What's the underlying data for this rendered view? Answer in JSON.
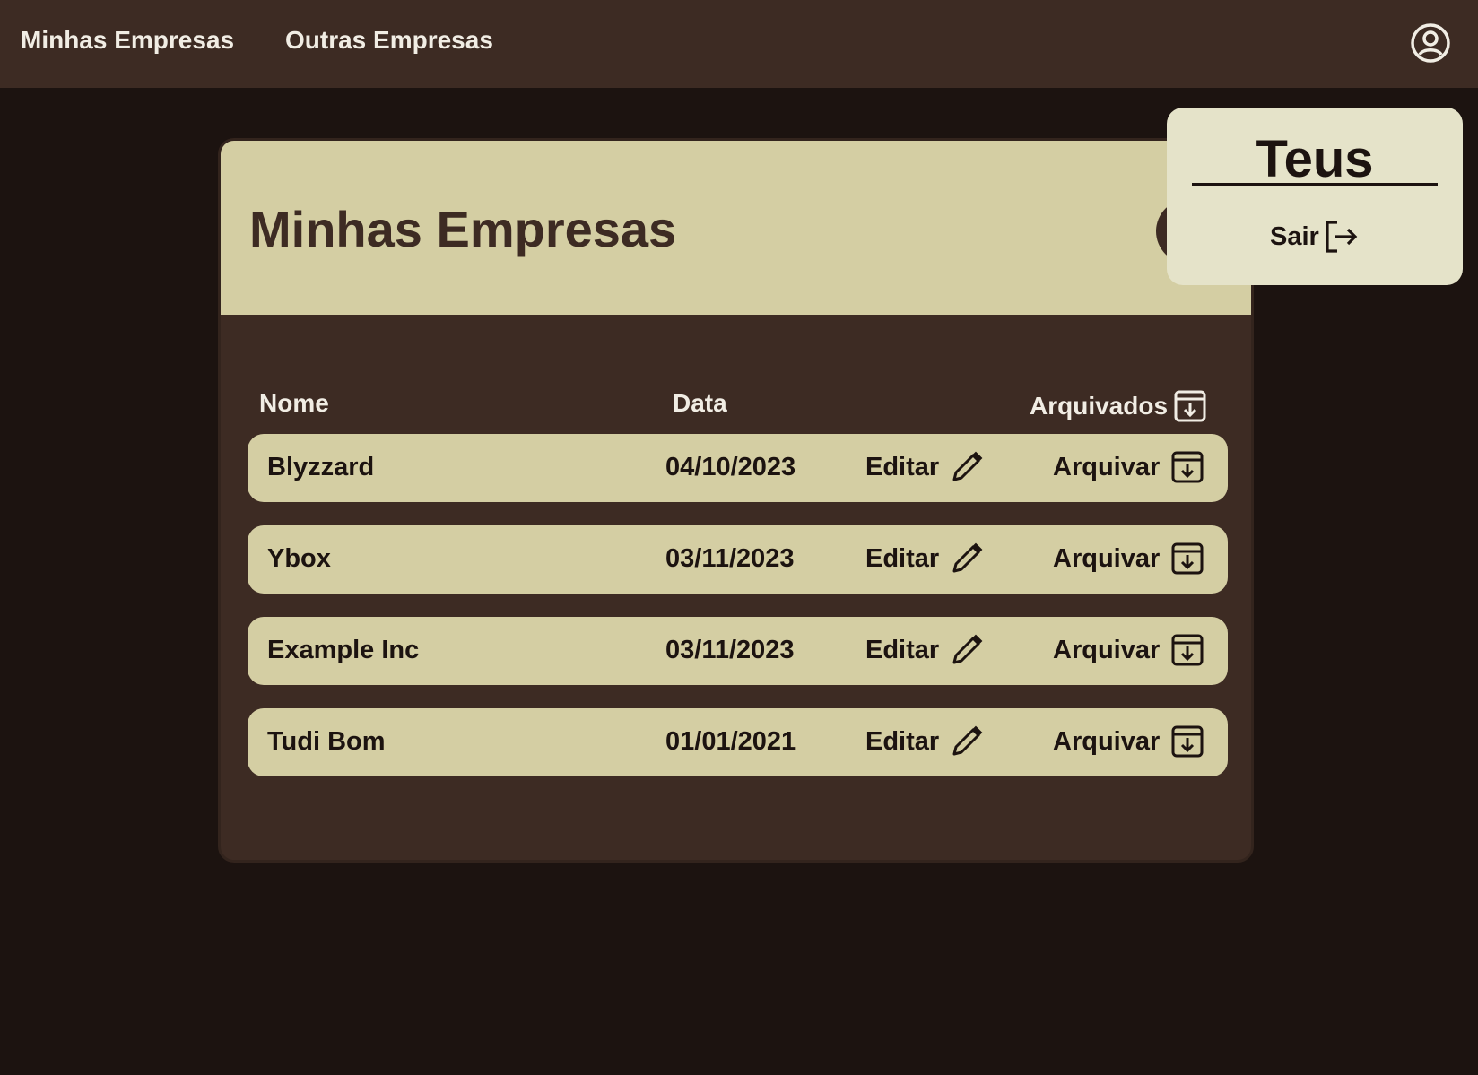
{
  "nav": {
    "links": [
      "Minhas Empresas",
      "Outras Empresas"
    ]
  },
  "panel": {
    "title": "Minhas Empresas",
    "columns": {
      "name": "Nome",
      "date": "Data",
      "archived": "Arquivados"
    },
    "rows": [
      {
        "name": "Blyzzard",
        "date": "04/10/2023",
        "edit": "Editar",
        "archive": "Arquivar"
      },
      {
        "name": "Ybox",
        "date": "03/11/2023",
        "edit": "Editar",
        "archive": "Arquivar"
      },
      {
        "name": "Example Inc",
        "date": "03/11/2023",
        "edit": "Editar",
        "archive": "Arquivar"
      },
      {
        "name": "Tudi Bom",
        "date": "01/01/2021",
        "edit": "Editar",
        "archive": "Arquivar"
      }
    ]
  },
  "user_menu": {
    "title": "Teus",
    "exit_label": "Sair"
  },
  "icons": {
    "user": "user-circle-icon",
    "edit": "pencil-icon",
    "archive": "archive-box-icon",
    "exit": "logout-icon"
  },
  "colors": {
    "topbar": "#3d2b23",
    "background": "#1c1310",
    "row": "#d4cea3",
    "popup": "#e5e3c9",
    "text_light": "#f1ede4",
    "text_dark": "#1c1310"
  }
}
